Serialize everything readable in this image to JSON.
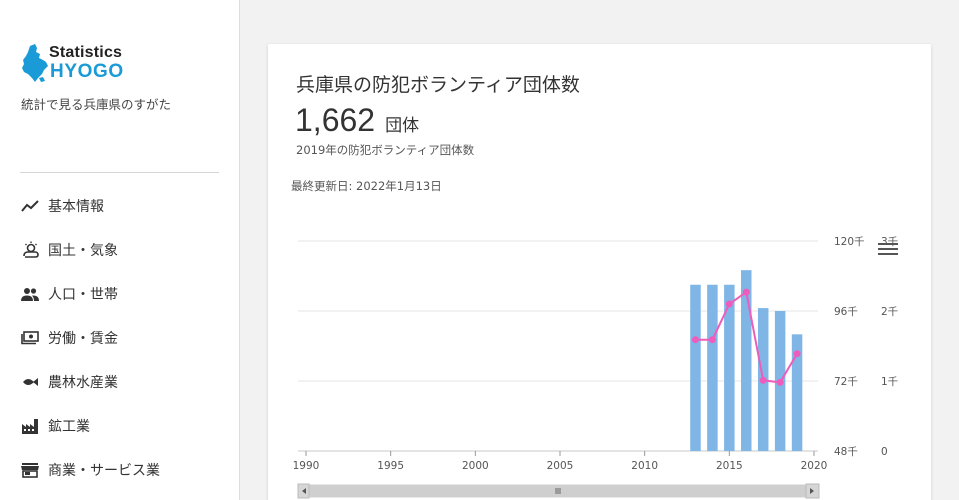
{
  "sidebar": {
    "logo_top": "Statistics",
    "logo_bottom": "HYOGO",
    "tagline": "統計で見る兵庫県のすがた",
    "items": [
      {
        "label": "基本情報",
        "icon": "trend-line-icon"
      },
      {
        "label": "国土・気象",
        "icon": "weather-icon"
      },
      {
        "label": "人口・世帯",
        "icon": "people-icon"
      },
      {
        "label": "労働・賃金",
        "icon": "money-icon"
      },
      {
        "label": "農林水産業",
        "icon": "fish-icon"
      },
      {
        "label": "鉱工業",
        "icon": "factory-icon"
      },
      {
        "label": "商業・サービス業",
        "icon": "store-icon"
      }
    ]
  },
  "card": {
    "title": "兵庫県の防犯ボランティア団体数",
    "value": "1,662",
    "unit": "団体",
    "caption": "2019年の防犯ボランティア団体数",
    "updated": "最終更新日: 2022年1月13日"
  },
  "chart_data": {
    "type": "bar",
    "x_ticks": [
      "1990",
      "1995",
      "2000",
      "2005",
      "2010",
      "2015",
      "2020"
    ],
    "xlim": [
      1990,
      2020
    ],
    "left_axis": {
      "ticks": [
        "48千",
        "72千",
        "96千",
        "120千"
      ],
      "range": [
        48,
        120
      ]
    },
    "right_axis": {
      "ticks": [
        "0",
        "1千",
        "2千",
        "3千"
      ],
      "range": [
        0,
        3
      ]
    },
    "bars": {
      "years": [
        2013,
        2014,
        2015,
        2016,
        2017,
        2018,
        2019
      ],
      "values": [
        105,
        105,
        105,
        110,
        97,
        96,
        88
      ],
      "color": "#7fb6e6"
    },
    "line": {
      "years": [
        2013,
        2014,
        2015,
        2016,
        2017,
        2018,
        2019
      ],
      "values": [
        1.59,
        1.59,
        2.1,
        2.27,
        1.01,
        0.98,
        1.39
      ],
      "color": "#ee5cbc"
    },
    "grid": true
  }
}
